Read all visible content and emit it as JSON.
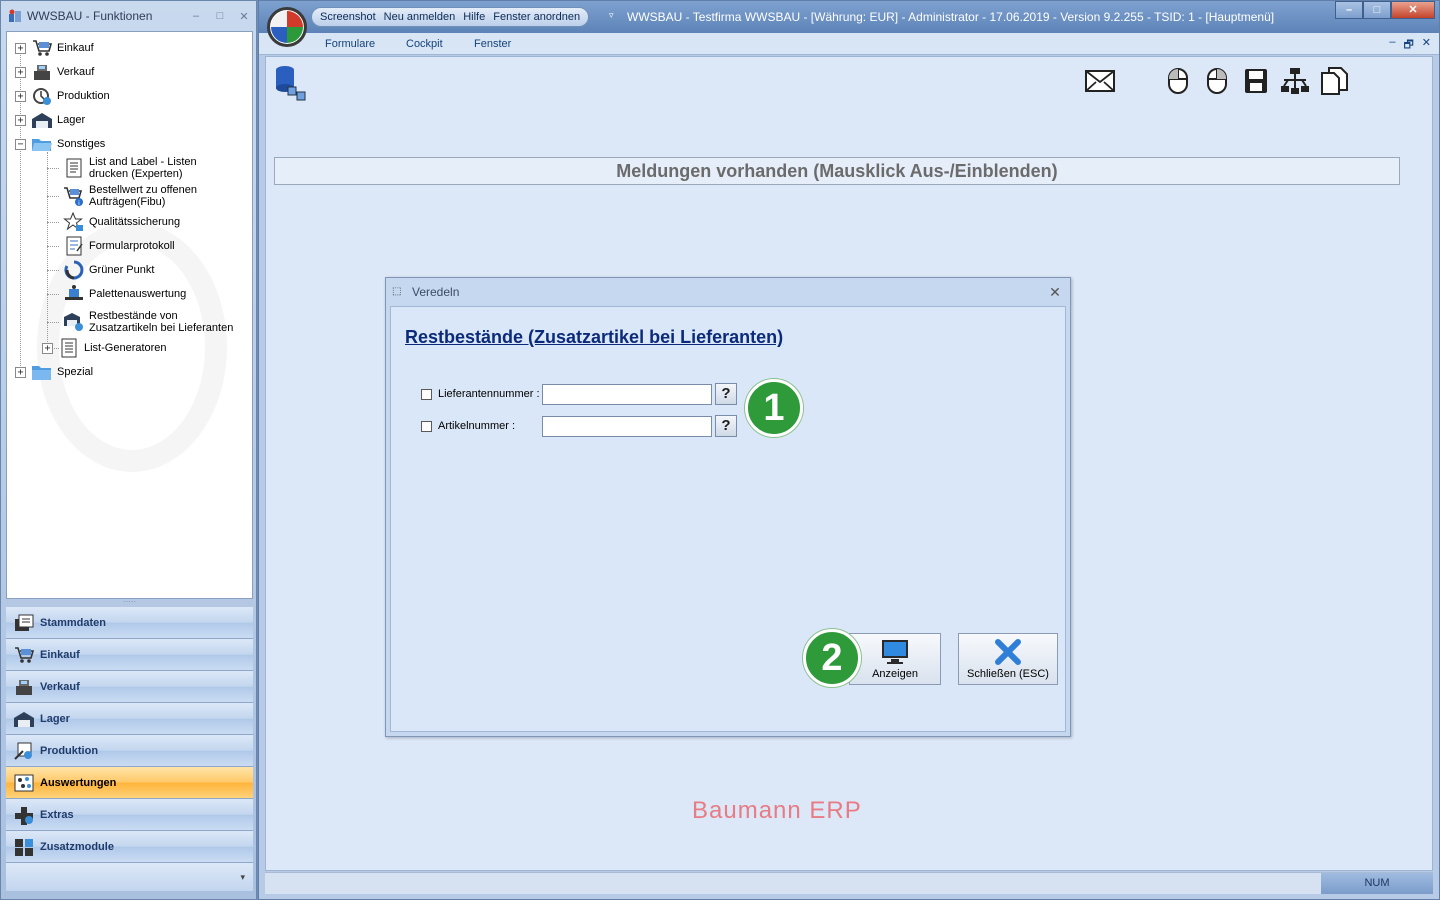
{
  "left_window": {
    "title": "WWSBAU - Funktionen",
    "min": "–",
    "max": "□",
    "close": "✕",
    "tree": [
      {
        "label": "Einkauf",
        "icon": "cart-icon",
        "expander": "+"
      },
      {
        "label": "Verkauf",
        "icon": "cash-register-icon",
        "expander": "+"
      },
      {
        "label": "Produktion",
        "icon": "production-icon",
        "expander": "+"
      },
      {
        "label": "Lager",
        "icon": "warehouse-icon",
        "expander": "+"
      },
      {
        "label": "Sonstiges",
        "icon": "folder-open-icon",
        "expander": "−"
      },
      {
        "label": "List and Label - Listen\ndrucken (Experten)",
        "icon": "list-document-icon"
      },
      {
        "label": "Bestellwert zu offenen\nAufträgen(Fibu)",
        "icon": "cart-info-icon"
      },
      {
        "label": "Qualitätssicherung",
        "icon": "star-lock-icon"
      },
      {
        "label": "Formularprotokoll",
        "icon": "form-protocol-icon"
      },
      {
        "label": "Grüner Punkt",
        "icon": "recycle-icon"
      },
      {
        "label": "Palettenauswertung",
        "icon": "pallet-icon"
      },
      {
        "label": "Restbestände von\nZusatzartikeln bei Lieferanten",
        "icon": "remaining-stock-icon"
      },
      {
        "label": "List-Generatoren",
        "icon": "list-generator-icon",
        "expander": "+"
      },
      {
        "label": "Spezial",
        "icon": "folder-icon",
        "expander": "+"
      }
    ],
    "splitter_grip": "·····",
    "nav": [
      {
        "label": "Stammdaten",
        "icon": "master-data-icon"
      },
      {
        "label": "Einkauf",
        "icon": "cart-icon"
      },
      {
        "label": "Verkauf",
        "icon": "cash-register-icon"
      },
      {
        "label": "Lager",
        "icon": "warehouse-icon"
      },
      {
        "label": "Produktion",
        "icon": "production-icon"
      },
      {
        "label": "Auswertungen",
        "icon": "analytics-icon",
        "active": true
      },
      {
        "label": "Extras",
        "icon": "extras-icon"
      },
      {
        "label": "Zusatzmodule",
        "icon": "modules-icon"
      }
    ],
    "nav_more": "▾"
  },
  "main_window": {
    "quick_access": [
      "Screenshot",
      "Neu anmelden",
      "Hilfe",
      "Fenster anordnen"
    ],
    "quick_chevron": "▿",
    "title": "WWSBAU - Testfirma WWSBAU - [Währung: EUR] - Administrator - 17.06.2019 - Version 9.2.255 - TSID: 1  - [Hauptmenü]",
    "controls": {
      "min": "–",
      "max": "□",
      "close": "✕"
    },
    "ribbon_tabs": [
      "Formulare",
      "Cockpit",
      "Fenster"
    ],
    "mdi_controls": {
      "min": "–",
      "restore": "🗗",
      "close": "✕"
    },
    "toolbar_icons": [
      "mail-icon",
      "mouse-left-icon",
      "mouse-right-icon",
      "floppy-icon",
      "network-icon",
      "document-copy-icon"
    ],
    "messages_bar": "Meldungen vorhanden  (Mausklick Aus-/Einblenden)",
    "watermark": "Baumann ERP",
    "status_num": "NUM"
  },
  "dialog": {
    "title": "Veredeln",
    "close": "✕",
    "heading": "Restbestände  (Zusatzartikel bei Lieferanten)",
    "fields": [
      {
        "label": "Lieferantennummer :",
        "value": "",
        "help": "?"
      },
      {
        "label": "Artikelnummer :",
        "value": "",
        "help": "?"
      }
    ],
    "badge1": "1",
    "badge2": "2",
    "show_button": "Anzeigen",
    "close_button": "Schließen (ESC)"
  },
  "colors": {
    "accent": "#ffb43a",
    "badge": "#2e9a3a",
    "heading": "#0b2a7a",
    "watermark": "#e87b83"
  }
}
